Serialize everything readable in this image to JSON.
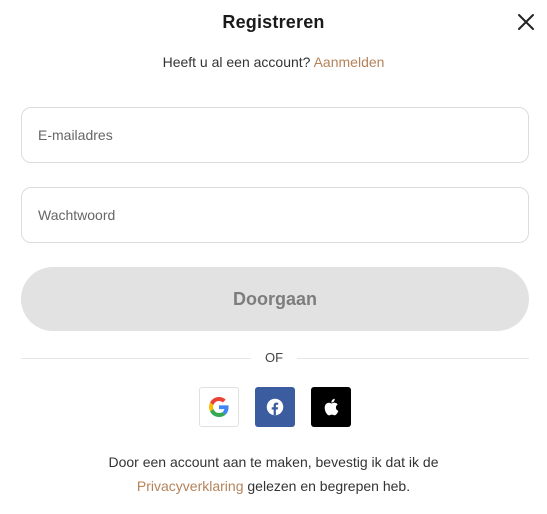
{
  "header": {
    "title": "Registreren"
  },
  "signin": {
    "prompt": "Heeft u al een account?",
    "link": "Aanmelden"
  },
  "form": {
    "email_placeholder": "E-mailadres",
    "password_placeholder": "Wachtwoord",
    "continue_label": "Doorgaan"
  },
  "divider": {
    "label": "OF"
  },
  "social": [
    {
      "name": "google",
      "icon": "google-icon"
    },
    {
      "name": "facebook",
      "icon": "facebook-icon",
      "color": "#3b5c9e"
    },
    {
      "name": "apple",
      "icon": "apple-icon",
      "color": "#000000"
    }
  ],
  "terms": {
    "before": "Door een account aan te maken, bevestig ik dat ik de",
    "link": "Privacyverklaring",
    "after": "gelezen en begrepen heb."
  },
  "colors": {
    "accent": "#b5835a",
    "button_disabled_bg": "#e2e2e2",
    "button_disabled_text": "#7d7d7d"
  }
}
